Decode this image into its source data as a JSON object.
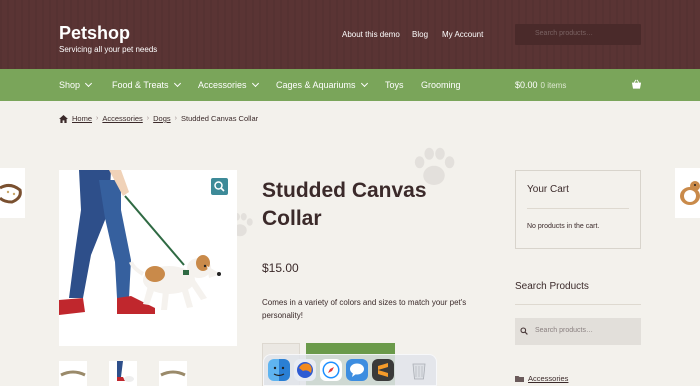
{
  "header": {
    "site_title": "Petshop",
    "site_description": "Servicing all your pet needs",
    "links": [
      "About this demo",
      "Blog",
      "My Account"
    ],
    "search_placeholder": "Search products…"
  },
  "nav": {
    "items": [
      "Shop",
      "Food & Treats",
      "Accessories",
      "Cages & Aquariums",
      "Toys",
      "Grooming"
    ],
    "cart_total": "$0.00",
    "cart_count": "0 items"
  },
  "breadcrumb": {
    "items": [
      "Home",
      "Accessories",
      "Dogs"
    ],
    "current": "Studded Canvas Collar"
  },
  "product": {
    "title": "Studded Canvas Collar",
    "price": "$15.00",
    "description": "Comes in a variety of colors and sizes to match your pet's personality!"
  },
  "sidebar": {
    "cart_title": "Your Cart",
    "cart_empty": "No products in the cart.",
    "search_title": "Search Products",
    "search_placeholder": "Search products…",
    "category_link": "Accessories"
  },
  "colors": {
    "header_bg": "#5a3434",
    "nav_bg": "#7aa55a",
    "page_bg": "#f3f1ec",
    "zoom_button": "#3d8a98"
  },
  "dock": {
    "icons": [
      "finder-icon",
      "firefox-icon",
      "safari-icon",
      "messages-icon",
      "sublime-text-icon",
      "trash-icon"
    ]
  }
}
